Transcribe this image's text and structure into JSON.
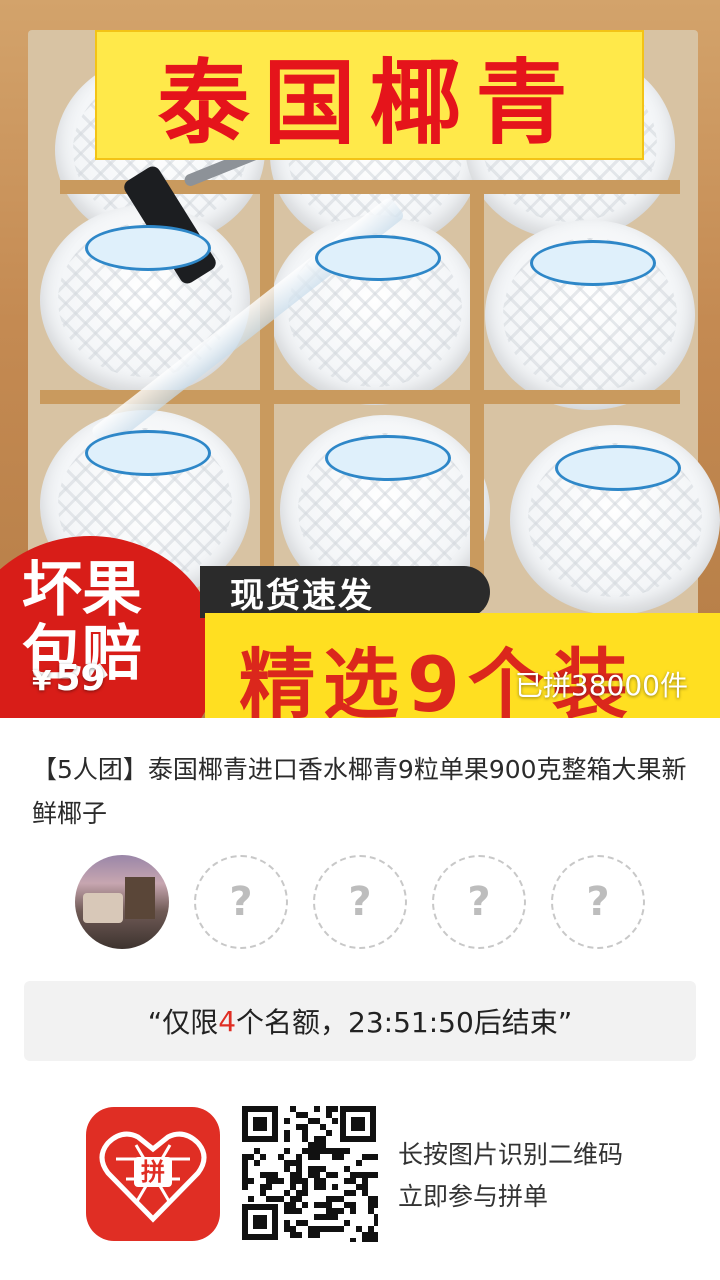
{
  "hero": {
    "banner_title": "泰国椰青",
    "badge_text": "坏果包赔",
    "shipping_text": "现货速发",
    "strip_text": "精选9个装",
    "price_symbol": "¥",
    "price": "59",
    "sold_text": "已拼38000件"
  },
  "product": {
    "title": "【5人团】泰国椰青进口香水椰青9粒单果900克整箱大果新鲜椰子"
  },
  "group": {
    "empty_slot_symbol": "?"
  },
  "notice": {
    "prefix": "“仅限",
    "count": "4",
    "suffix": "个名额，23:51:50后结束”"
  },
  "footer": {
    "scan_line1": "长按图片识别二维码",
    "scan_line2": "立即参与拼单",
    "logo_text": "拼"
  },
  "colors": {
    "brand_red": "#e02e24",
    "banner_yellow": "#ffe94a"
  }
}
